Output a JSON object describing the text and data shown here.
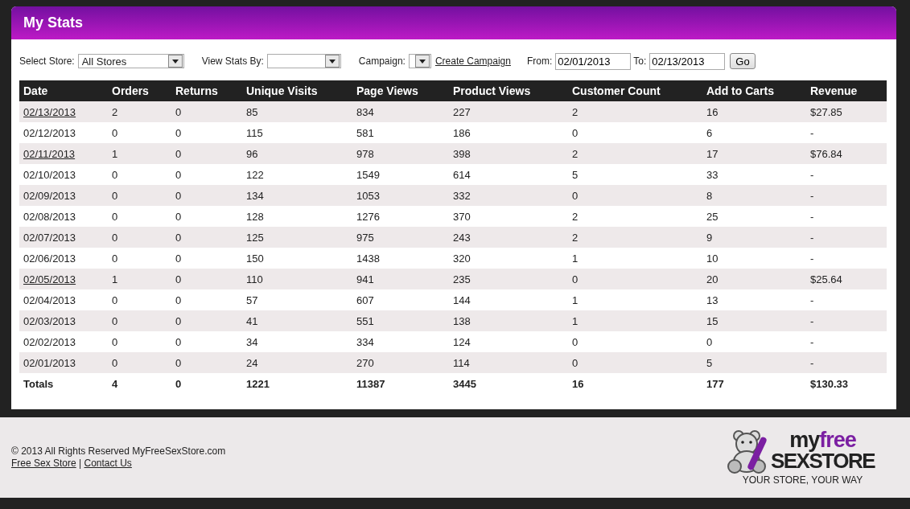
{
  "panel": {
    "title": "My Stats"
  },
  "filters": {
    "store_label": "Select Store:",
    "store_value": "All Stores",
    "view_label": "View Stats By:",
    "campaign_label": "Campaign:",
    "create_link": "Create Campaign",
    "from_label": "From:",
    "from_value": "02/01/2013",
    "to_label": "To:",
    "to_value": "02/13/2013",
    "go_button": "Go"
  },
  "table": {
    "columns": [
      "Date",
      "Orders",
      "Returns",
      "Unique Visits",
      "Page Views",
      "Product Views",
      "Customer Count",
      "Add to Carts",
      "Revenue"
    ],
    "rows": [
      {
        "linked": true,
        "cells": [
          "02/13/2013",
          "2",
          "0",
          "85",
          "834",
          "227",
          "2",
          "16",
          "$27.85"
        ]
      },
      {
        "linked": false,
        "cells": [
          "02/12/2013",
          "0",
          "0",
          "115",
          "581",
          "186",
          "0",
          "6",
          "-"
        ]
      },
      {
        "linked": true,
        "cells": [
          "02/11/2013",
          "1",
          "0",
          "96",
          "978",
          "398",
          "2",
          "17",
          "$76.84"
        ]
      },
      {
        "linked": false,
        "cells": [
          "02/10/2013",
          "0",
          "0",
          "122",
          "1549",
          "614",
          "5",
          "33",
          "-"
        ]
      },
      {
        "linked": false,
        "cells": [
          "02/09/2013",
          "0",
          "0",
          "134",
          "1053",
          "332",
          "0",
          "8",
          "-"
        ]
      },
      {
        "linked": false,
        "cells": [
          "02/08/2013",
          "0",
          "0",
          "128",
          "1276",
          "370",
          "2",
          "25",
          "-"
        ]
      },
      {
        "linked": false,
        "cells": [
          "02/07/2013",
          "0",
          "0",
          "125",
          "975",
          "243",
          "2",
          "9",
          "-"
        ]
      },
      {
        "linked": false,
        "cells": [
          "02/06/2013",
          "0",
          "0",
          "150",
          "1438",
          "320",
          "1",
          "10",
          "-"
        ]
      },
      {
        "linked": true,
        "cells": [
          "02/05/2013",
          "1",
          "0",
          "110",
          "941",
          "235",
          "0",
          "20",
          "$25.64"
        ]
      },
      {
        "linked": false,
        "cells": [
          "02/04/2013",
          "0",
          "0",
          "57",
          "607",
          "144",
          "1",
          "13",
          "-"
        ]
      },
      {
        "linked": false,
        "cells": [
          "02/03/2013",
          "0",
          "0",
          "41",
          "551",
          "138",
          "1",
          "15",
          "-"
        ]
      },
      {
        "linked": false,
        "cells": [
          "02/02/2013",
          "0",
          "0",
          "34",
          "334",
          "124",
          "0",
          "0",
          "-"
        ]
      },
      {
        "linked": false,
        "cells": [
          "02/01/2013",
          "0",
          "0",
          "24",
          "270",
          "114",
          "0",
          "5",
          "-"
        ]
      }
    ],
    "totals": [
      "Totals",
      "4",
      "0",
      "1221",
      "11387",
      "3445",
      "16",
      "177",
      "$130.33"
    ]
  },
  "footer": {
    "copyright": "© 2013 All Rights Reserved MyFreeSexStore.com",
    "links": [
      "Free Sex Store",
      "Contact Us"
    ],
    "separator": "|"
  },
  "logo": {
    "word_1": "my",
    "word_2": "free",
    "word_3": "SEXSTORE",
    "tagline": "YOUR STORE, YOUR WAY"
  }
}
